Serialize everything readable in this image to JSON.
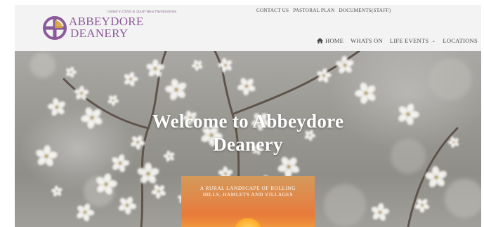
{
  "site": {
    "tagline": "United in Christ in South West Herefordshire",
    "logo_line1": "ABBEYDORE",
    "logo_line2": "DEANERY",
    "brand_color": "#8b5a9a"
  },
  "top_menu": {
    "items": [
      "CONTACT US",
      "PASTORAL PLAN",
      "DOCUMENTS(STAFF)"
    ]
  },
  "main_nav": {
    "home_icon": "home-icon",
    "items": [
      "HOME",
      "WHATS ON",
      "LIFE EVENTS",
      "LOCATIONS"
    ],
    "dropdown_chevron": "⌄"
  },
  "hero": {
    "title_line1": "Welcome to Abbeydore",
    "title_line2": "Deanery",
    "image_desc": "white blossom branches on grey background"
  },
  "promo": {
    "line1": "A RURAL LANDSCAPE OF ROLLING",
    "line2": "HILLS, HAMLETS AND VILLAGES",
    "color": "#e0884a"
  }
}
